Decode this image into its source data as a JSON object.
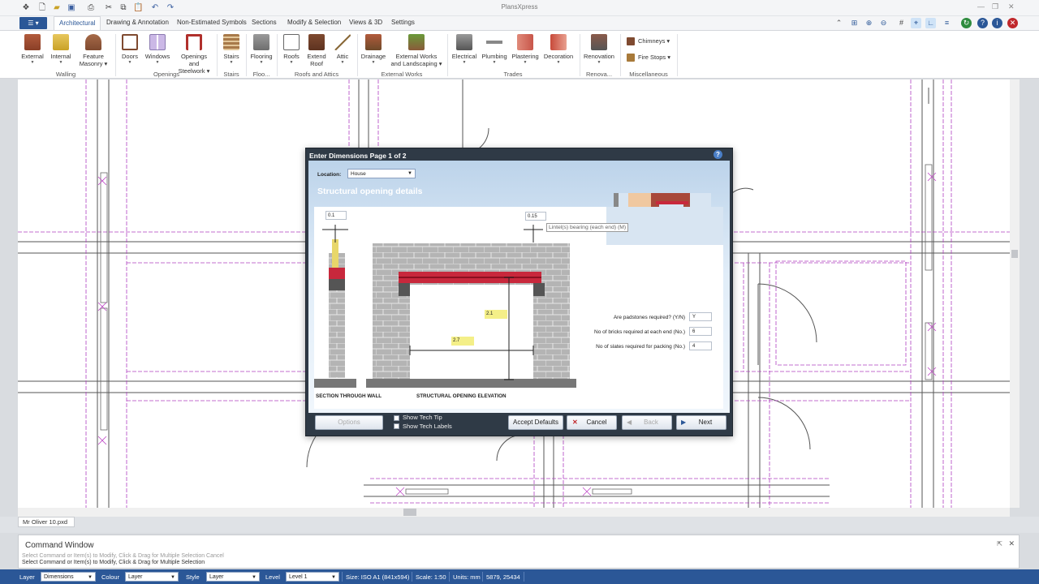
{
  "app": {
    "title": "PlansXpress"
  },
  "ribbon": {
    "file_tab": "☰ ▾",
    "tabs": [
      "Architectural",
      "Drawing & Annotation",
      "Non-Estimated Symbols",
      "Sections",
      "Modify & Selection",
      "Views & 3D",
      "Settings"
    ],
    "active_tab": "Architectural",
    "buttons": {
      "external": "External",
      "internal": "Internal",
      "feature_masonry_1": "Feature",
      "feature_masonry_2": "Masonry",
      "doors": "Doors",
      "windows": "Windows",
      "openings_1": "Openings and",
      "openings_2": "Steelwork",
      "stairs": "Stairs",
      "flooring": "Flooring",
      "roofs": "Roofs",
      "extend_roof_1": "Extend",
      "extend_roof_2": "Roof",
      "attic": "Attic",
      "drainage": "Drainage",
      "external_works_1": "External Works",
      "external_works_2": "and Landscaping",
      "electrical": "Electrical",
      "plumbing": "Plumbing",
      "plastering": "Plastering",
      "decoration": "Decoration",
      "renovation": "Renovation",
      "chimneys": "Chimneys",
      "fire_stops": "Fire Stops"
    },
    "groups": {
      "walling": "Walling",
      "openings": "Openings",
      "stairs": "Stairs",
      "floo": "Floo...",
      "roofs_attics": "Roofs and Attics",
      "external_works": "External Works",
      "trades": "Trades",
      "renova": "Renova...",
      "misc": "Miscellaneous"
    }
  },
  "document": {
    "tab": "Mr Oliver 10.pxd"
  },
  "dialog": {
    "title": "Enter Dimensions    Page 1 of 2",
    "help": "?",
    "location_label": "Location:",
    "location_value": "House",
    "section_heading": "Structural opening details",
    "diagram": {
      "dim_wall": "0.1",
      "dim_bearing": "0.15",
      "dim_height": "2.1",
      "dim_width": "2.7",
      "label_section": "SECTION THROUGH WALL",
      "label_elevation": "STRUCTURAL  OPENING ELEVATION"
    },
    "tooltip": "Lintel(s) bearing (each end) (M)",
    "fields": [
      {
        "label": "Are padstones required? (Y/N)",
        "value": "Y"
      },
      {
        "label": "No of bricks required at each end (No.)",
        "value": "6"
      },
      {
        "label": "No of slates required for packing (No.)",
        "value": "4"
      }
    ],
    "buttons": {
      "options": "Options",
      "show_tech_tip": "Show Tech Tip",
      "show_tech_labels": "Show Tech Labels",
      "accept_defaults": "Accept Defaults",
      "cancel": "Cancel",
      "back": "Back",
      "next": "Next"
    }
  },
  "command_window": {
    "title": "Command Window",
    "line1": "Select Command or Item(s) to Modify, Click & Drag for Multiple Selection    Cancel",
    "line2": "Select Command or Item(s) to Modify, Click & Drag for Multiple Selection"
  },
  "statusbar": {
    "layer_label": "Layer",
    "layer_value": "Dimensions",
    "colour_label": "Colour",
    "colour_value": "Layer",
    "style_label": "Style",
    "style_value": "Layer",
    "level_label": "Level",
    "level_value": "Level 1",
    "size": "Size: ISO A1 (841x594)",
    "scale": "Scale: 1:50",
    "units": "Units: mm",
    "coords": "5879, 25434"
  },
  "colors": {
    "accent": "#2b5797",
    "wall_magenta": "#c04ac8",
    "brick": "#c8283c",
    "block": "#a8a8a8"
  }
}
